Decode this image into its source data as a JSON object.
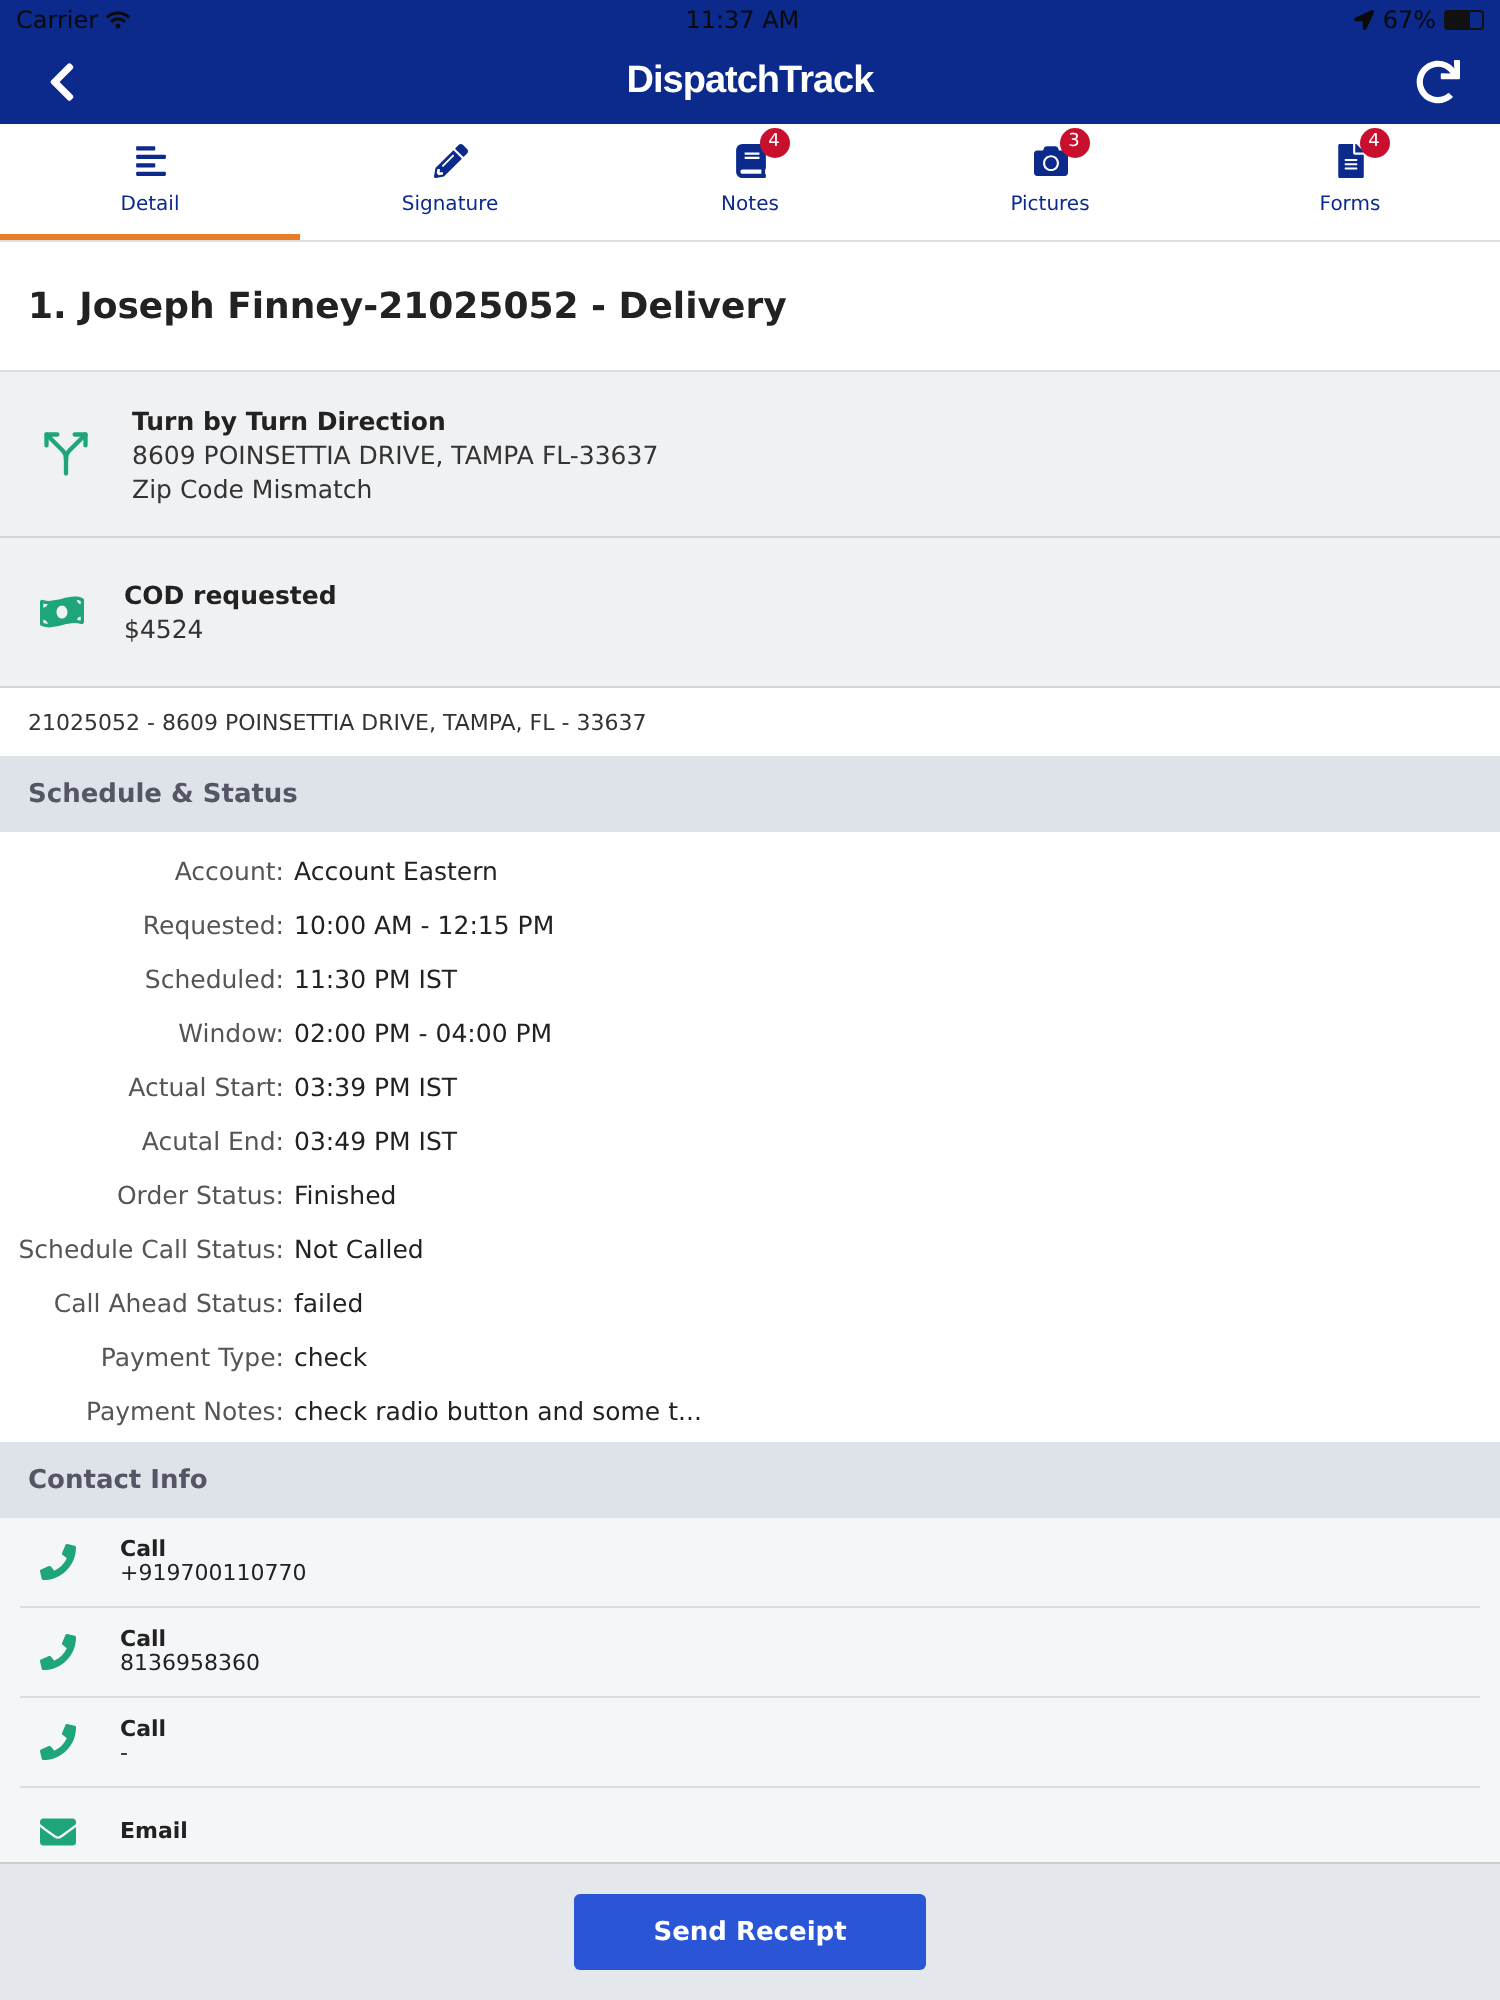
{
  "status_bar": {
    "carrier": "Carrier",
    "time": "11:37 AM",
    "battery": "67%"
  },
  "nav": {
    "title": "DispatchTrack"
  },
  "tabs": [
    {
      "label": "Detail",
      "kind": "detail",
      "selected": true
    },
    {
      "label": "Signature",
      "kind": "signature",
      "selected": false
    },
    {
      "label": "Notes",
      "kind": "notes",
      "badge": "4",
      "selected": false
    },
    {
      "label": "Pictures",
      "kind": "pictures",
      "badge": "3",
      "selected": false
    },
    {
      "label": "Forms",
      "kind": "forms",
      "badge": "4",
      "selected": false
    }
  ],
  "order_title": "1. Joseph Finney-21025052 - Delivery",
  "info_rows": [
    {
      "kind": "direction",
      "title": "Turn by Turn Direction",
      "lines": [
        "8609 POINSETTIA DRIVE, TAMPA FL-33637",
        "Zip Code Mismatch"
      ]
    },
    {
      "kind": "cod",
      "title": "COD requested",
      "lines": [
        "$4524"
      ]
    }
  ],
  "address": "21025052 - 8609 POINSETTIA DRIVE, TAMPA, FL - 33637",
  "schedule": {
    "header": "Schedule & Status",
    "rows": [
      {
        "label": "Account:",
        "value": "Account Eastern"
      },
      {
        "label": "Requested:",
        "value": "10:00 AM - 12:15 PM"
      },
      {
        "label": "Scheduled:",
        "value": "11:30 PM IST"
      },
      {
        "label": "Window:",
        "value": "02:00 PM - 04:00 PM"
      },
      {
        "label": "Actual Start:",
        "value": "03:39 PM IST"
      },
      {
        "label": "Acutal End:",
        "value": "03:49 PM IST"
      },
      {
        "label": "Order Status:",
        "value": "Finished"
      },
      {
        "label": "Schedule Call Status:",
        "value": "Not Called"
      },
      {
        "label": "Call Ahead Status:",
        "value": "failed"
      },
      {
        "label": "Payment Type:",
        "value": "check"
      },
      {
        "label": "Payment Notes:",
        "value": "check radio button and some t..."
      }
    ]
  },
  "contact": {
    "header": "Contact Info",
    "items": [
      {
        "kind": "call",
        "label": "Call",
        "value": "+919700110770"
      },
      {
        "kind": "call",
        "label": "Call",
        "value": "8136958360"
      },
      {
        "kind": "call",
        "label": "Call",
        "value": "-"
      },
      {
        "kind": "email",
        "label": "Email"
      }
    ]
  },
  "footer": {
    "button": "Send Receipt"
  }
}
